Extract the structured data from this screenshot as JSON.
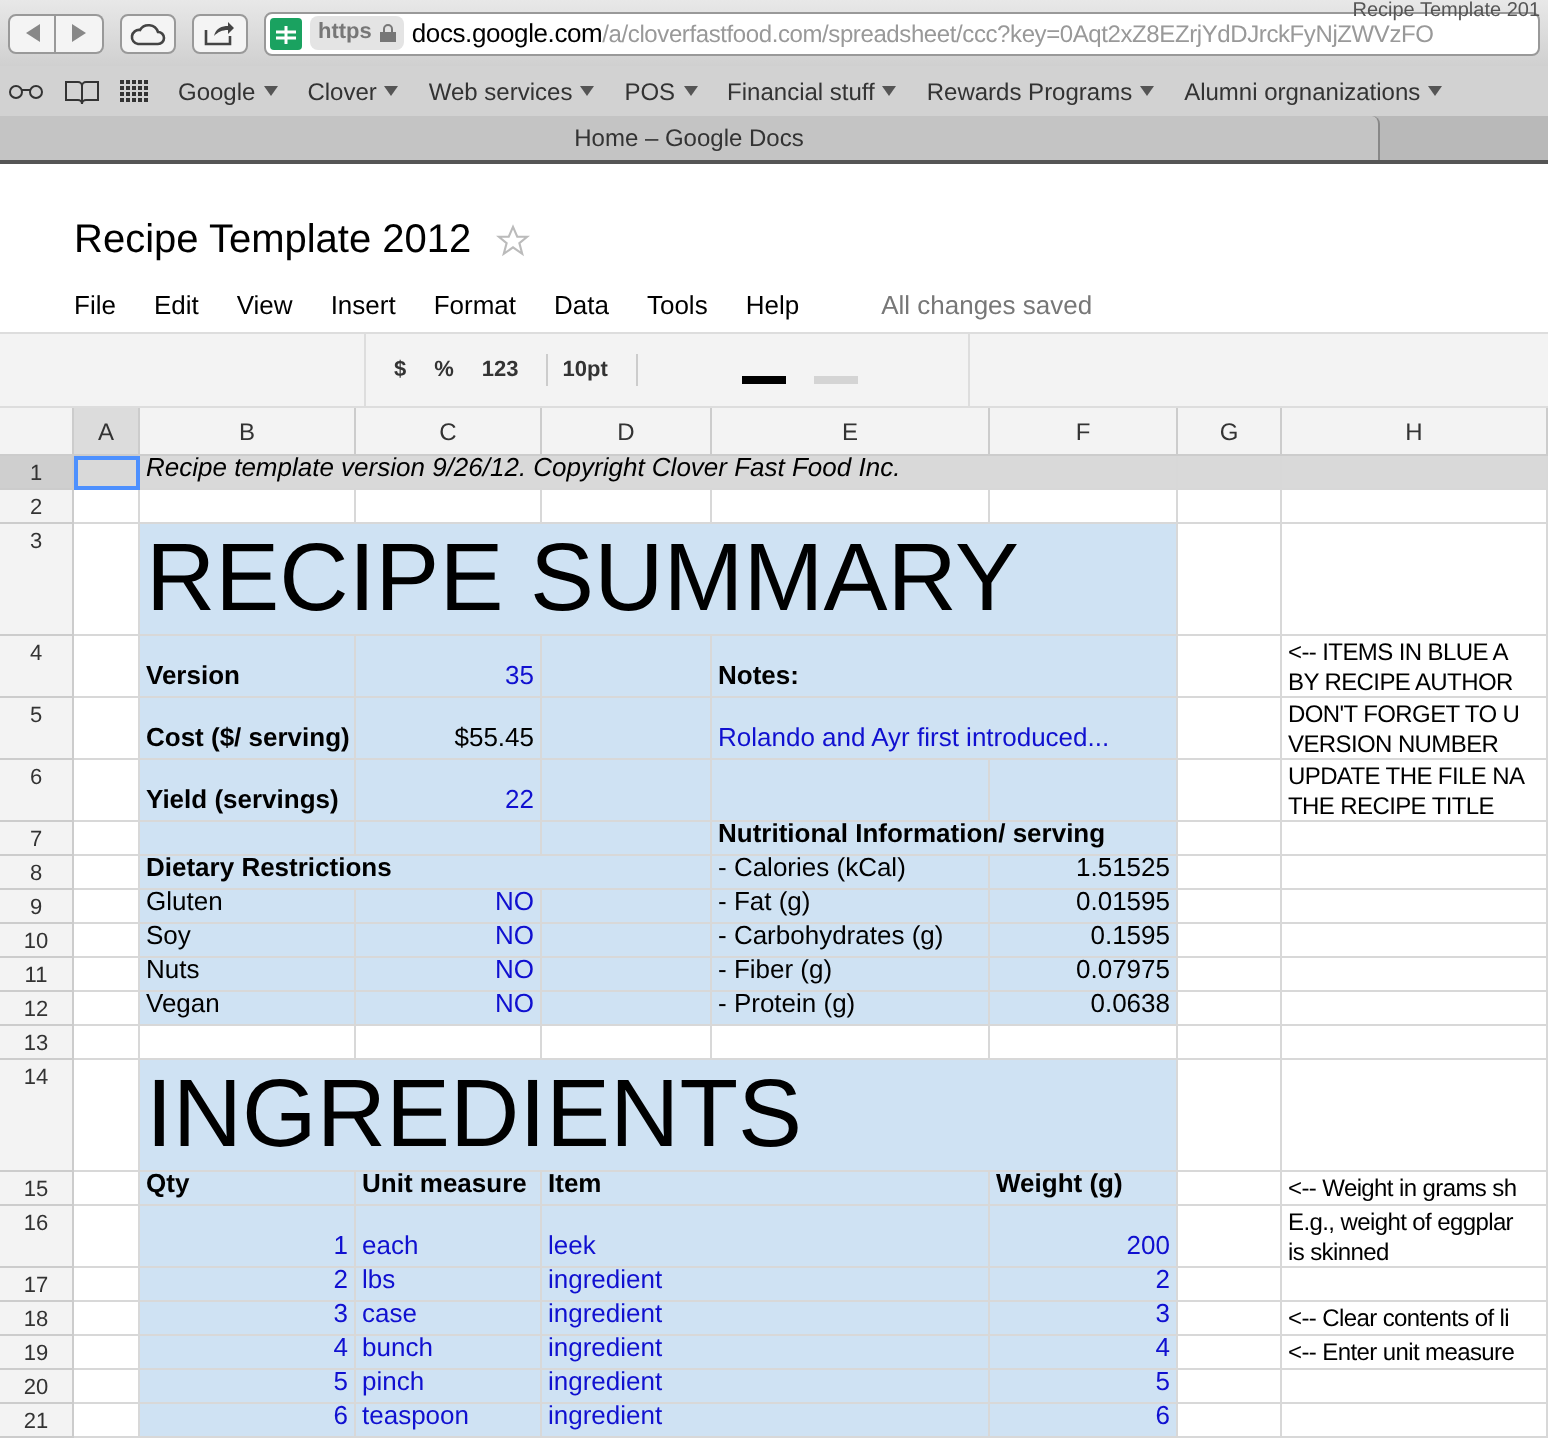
{
  "window": {
    "title": "Recipe Template 201"
  },
  "browser": {
    "url_secure": "https",
    "url_host": "docs.google.com",
    "url_path": "/a/cloverfastfood.com/spreadsheet/ccc?key=0Aqt2xZ8EZrjYdDJrckFyNjZWVzFO",
    "bookmarks": [
      "Google",
      "Clover",
      "Web services",
      "POS",
      "Financial stuff",
      "Rewards Programs",
      "Alumni orgnanizations"
    ],
    "tab": "Home – Google Docs"
  },
  "document": {
    "title": "Recipe Template 2012",
    "starred": false,
    "menu": [
      "File",
      "Edit",
      "View",
      "Insert",
      "Format",
      "Data",
      "Tools",
      "Help"
    ],
    "save_status": "All changes saved"
  },
  "toolbar": {
    "buttons": [
      "$",
      "%",
      "123"
    ],
    "font_size": "10pt"
  },
  "columns": [
    {
      "label": "A",
      "selected": true
    },
    {
      "label": "B",
      "selected": false
    },
    {
      "label": "C",
      "selected": false
    },
    {
      "label": "D",
      "selected": false
    },
    {
      "label": "E",
      "selected": false
    },
    {
      "label": "F",
      "selected": false
    },
    {
      "label": "G",
      "selected": false
    },
    {
      "label": "H",
      "selected": false
    }
  ],
  "rows": [
    {
      "number": "1",
      "selected": true,
      "shaded": false,
      "cells": [
        {},
        {
          "kind": "caption",
          "text": "Recipe template version 9/26/12. Copyright Clover Fast Food Inc."
        },
        {},
        {},
        {},
        {},
        {},
        {}
      ]
    },
    {
      "number": "2",
      "selected": false,
      "shaded": false,
      "cells": [
        {},
        {},
        {},
        {},
        {},
        {},
        {},
        {}
      ]
    },
    {
      "number": "3",
      "selected": false,
      "shaded": true,
      "cells": [
        {},
        {
          "kind": "title",
          "text": "RECIPE SUMMARY"
        },
        {},
        {},
        {},
        {},
        {},
        {}
      ]
    },
    {
      "number": "4",
      "selected": false,
      "shaded": true,
      "cells": [
        {},
        {
          "kind": "heading",
          "text": "Version"
        },
        {
          "kind": "input_number",
          "text": "35"
        },
        {},
        {
          "kind": "heading",
          "text": "Notes:"
        },
        {},
        {},
        {
          "kind": "note",
          "lines": [
            "<-- ITEMS IN BLUE A",
            "BY RECIPE AUTHOR"
          ]
        }
      ]
    },
    {
      "number": "5",
      "selected": false,
      "shaded": true,
      "cells": [
        {},
        {
          "kind": "heading",
          "text": "Cost ($/ serving)"
        },
        {
          "kind": "number",
          "text": "$55.45"
        },
        {},
        {
          "kind": "input_text",
          "text": "Rolando and Ayr first introduced..."
        },
        {},
        {},
        {
          "kind": "note",
          "lines": [
            "DON'T FORGET TO U",
            "VERSION NUMBER"
          ]
        }
      ]
    },
    {
      "number": "6",
      "selected": false,
      "shaded": true,
      "cells": [
        {},
        {
          "kind": "heading",
          "text": "Yield (servings)"
        },
        {
          "kind": "input_number",
          "text": "22"
        },
        {},
        {},
        {},
        {},
        {
          "kind": "note",
          "lines": [
            "UPDATE THE FILE NA",
            "THE RECIPE TITLE"
          ]
        }
      ]
    },
    {
      "number": "7",
      "selected": false,
      "shaded": true,
      "cells": [
        {},
        {},
        {},
        {},
        {
          "kind": "heading",
          "text": "Nutritional Information/ serving"
        },
        {},
        {},
        {}
      ]
    },
    {
      "number": "8",
      "selected": false,
      "shaded": true,
      "cells": [
        {},
        {
          "kind": "heading",
          "text": "Dietary Restrictions"
        },
        {},
        {},
        {
          "kind": "text",
          "text": "- Calories (kCal)"
        },
        {
          "kind": "number",
          "text": "1.51525"
        },
        {},
        {}
      ]
    },
    {
      "number": "9",
      "selected": false,
      "shaded": true,
      "cells": [
        {},
        {
          "kind": "text",
          "text": "Gluten"
        },
        {
          "kind": "input_number",
          "text": "NO"
        },
        {},
        {
          "kind": "text",
          "text": "- Fat (g)"
        },
        {
          "kind": "number",
          "text": "0.01595"
        },
        {},
        {}
      ]
    },
    {
      "number": "10",
      "selected": false,
      "shaded": true,
      "cells": [
        {},
        {
          "kind": "text",
          "text": "Soy"
        },
        {
          "kind": "input_number",
          "text": "NO"
        },
        {},
        {
          "kind": "text",
          "text": "- Carbohydrates (g)"
        },
        {
          "kind": "number",
          "text": "0.1595"
        },
        {},
        {}
      ]
    },
    {
      "number": "11",
      "selected": false,
      "shaded": true,
      "cells": [
        {},
        {
          "kind": "text",
          "text": "Nuts"
        },
        {
          "kind": "input_number",
          "text": "NO"
        },
        {},
        {
          "kind": "text",
          "text": "- Fiber (g)"
        },
        {
          "kind": "number",
          "text": "0.07975"
        },
        {},
        {}
      ]
    },
    {
      "number": "12",
      "selected": false,
      "shaded": true,
      "cells": [
        {},
        {
          "kind": "text",
          "text": "Vegan"
        },
        {
          "kind": "input_number",
          "text": "NO"
        },
        {},
        {
          "kind": "text",
          "text": "- Protein (g)"
        },
        {
          "kind": "number",
          "text": "0.0638"
        },
        {},
        {}
      ]
    },
    {
      "number": "13",
      "selected": false,
      "shaded": false,
      "cells": [
        {},
        {},
        {},
        {},
        {},
        {},
        {},
        {}
      ]
    },
    {
      "number": "14",
      "selected": false,
      "shaded": true,
      "cells": [
        {},
        {
          "kind": "title",
          "text": "INGREDIENTS"
        },
        {},
        {},
        {},
        {},
        {},
        {}
      ]
    },
    {
      "number": "15",
      "selected": false,
      "shaded": true,
      "cells": [
        {},
        {
          "kind": "heading",
          "text": "Qty"
        },
        {
          "kind": "heading",
          "text": "Unit measure"
        },
        {
          "kind": "heading",
          "text": "Item"
        },
        {},
        {
          "kind": "heading",
          "text": "Weight (g)"
        },
        {},
        {
          "kind": "note",
          "lines": [
            "<-- Weight in grams sh"
          ]
        }
      ]
    },
    {
      "number": "16",
      "selected": false,
      "shaded": true,
      "cells": [
        {},
        {
          "kind": "input_number",
          "text": "1"
        },
        {
          "kind": "input_text",
          "text": "each"
        },
        {
          "kind": "input_text",
          "text": "leek"
        },
        {},
        {
          "kind": "input_number",
          "text": "200"
        },
        {},
        {
          "kind": "note",
          "lines": [
            "E.g., weight of eggplar",
            "is skinned"
          ]
        }
      ]
    },
    {
      "number": "17",
      "selected": false,
      "shaded": true,
      "cells": [
        {},
        {
          "kind": "input_number",
          "text": "2"
        },
        {
          "kind": "input_text",
          "text": "lbs"
        },
        {
          "kind": "input_text",
          "text": "ingredient"
        },
        {},
        {
          "kind": "input_number",
          "text": "2"
        },
        {},
        {}
      ]
    },
    {
      "number": "18",
      "selected": false,
      "shaded": true,
      "cells": [
        {},
        {
          "kind": "input_number",
          "text": "3"
        },
        {
          "kind": "input_text",
          "text": "case"
        },
        {
          "kind": "input_text",
          "text": "ingredient"
        },
        {},
        {
          "kind": "input_number",
          "text": "3"
        },
        {},
        {
          "kind": "note",
          "lines": [
            "<-- Clear contents of li"
          ]
        }
      ]
    },
    {
      "number": "19",
      "selected": false,
      "shaded": true,
      "cells": [
        {},
        {
          "kind": "input_number",
          "text": "4"
        },
        {
          "kind": "input_text",
          "text": "bunch"
        },
        {
          "kind": "input_text",
          "text": "ingredient"
        },
        {},
        {
          "kind": "input_number",
          "text": "4"
        },
        {},
        {
          "kind": "note",
          "lines": [
            "<-- Enter unit measure"
          ]
        }
      ]
    },
    {
      "number": "20",
      "selected": false,
      "shaded": true,
      "cells": [
        {},
        {
          "kind": "input_number",
          "text": "5"
        },
        {
          "kind": "input_text",
          "text": "pinch"
        },
        {
          "kind": "input_text",
          "text": "ingredient"
        },
        {},
        {
          "kind": "input_number",
          "text": "5"
        },
        {},
        {}
      ]
    },
    {
      "number": "21",
      "selected": false,
      "shaded": true,
      "cells": [
        {},
        {
          "kind": "input_number",
          "text": "6"
        },
        {
          "kind": "input_text",
          "text": "teaspoon"
        },
        {
          "kind": "input_text",
          "text": "ingredient"
        },
        {},
        {
          "kind": "input_number",
          "text": "6"
        },
        {},
        {}
      ]
    }
  ]
}
